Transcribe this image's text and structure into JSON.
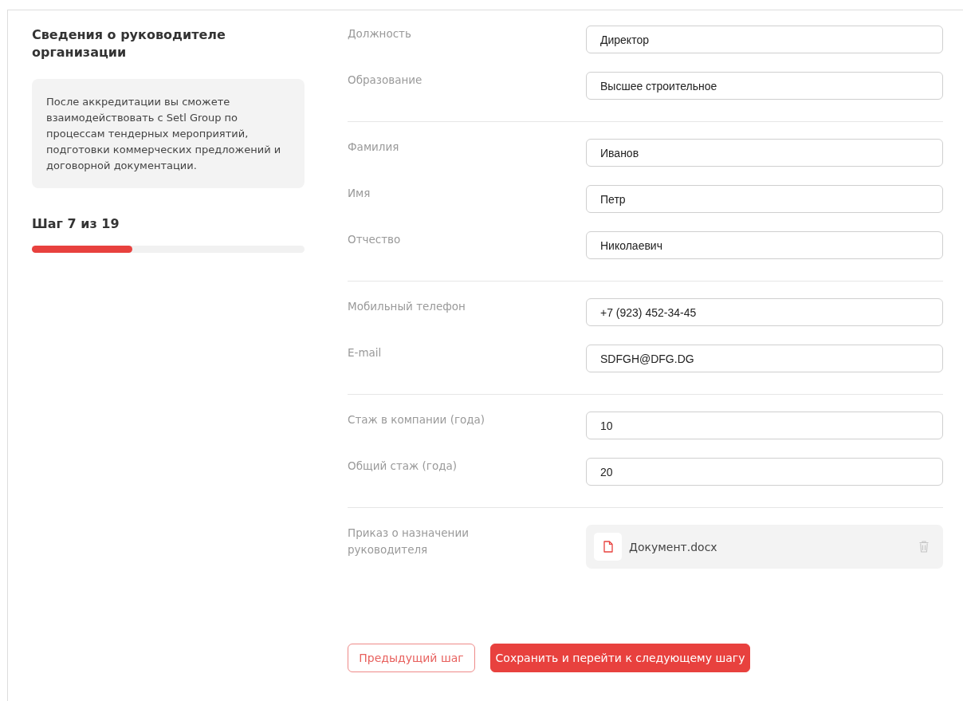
{
  "sidebar": {
    "title": "Сведения о руководителе организации",
    "info": "После аккредитации вы сможете взаимодействовать с Setl Group по процессам тендерных мероприятий, подготовки коммерческих предложений и договорной документации.",
    "step": "Шаг 7 из 19",
    "progress": {
      "level": 0.368
    }
  },
  "sections": [
    {
      "fields": [
        {
          "kind": "text",
          "label": "Должность",
          "value": "Директор"
        },
        {
          "kind": "text",
          "label": "Образование",
          "value": "Высшее строительное"
        }
      ]
    },
    {
      "fields": [
        {
          "kind": "text",
          "label": "Фамилия",
          "value": "Иванов"
        },
        {
          "kind": "text",
          "label": "Имя",
          "value": "Петр"
        },
        {
          "kind": "text",
          "label": "Отчество",
          "value": "Николаевич"
        }
      ]
    },
    {
      "fields": [
        {
          "kind": "text",
          "label": "Мобильный телефон",
          "value": "+7 (923) 452-34-45"
        },
        {
          "kind": "text",
          "label": "E-mail",
          "value": "SDFGH@DFG.DG"
        }
      ]
    },
    {
      "fields": [
        {
          "kind": "text",
          "label": "Стаж в компании (года)",
          "value": "10"
        },
        {
          "kind": "text",
          "label": "Общий стаж (года)",
          "value": "20"
        }
      ]
    },
    {
      "fields": [
        {
          "kind": "file",
          "label": "Приказ о назначении руководителя",
          "file_name": "Документ.docx"
        }
      ]
    }
  ],
  "buttons": [
    {
      "kind": "secondary",
      "label": "Предыдущий шаг"
    },
    {
      "kind": "primary",
      "label": "Сохранить и перейти к следующему шагу"
    }
  ]
}
